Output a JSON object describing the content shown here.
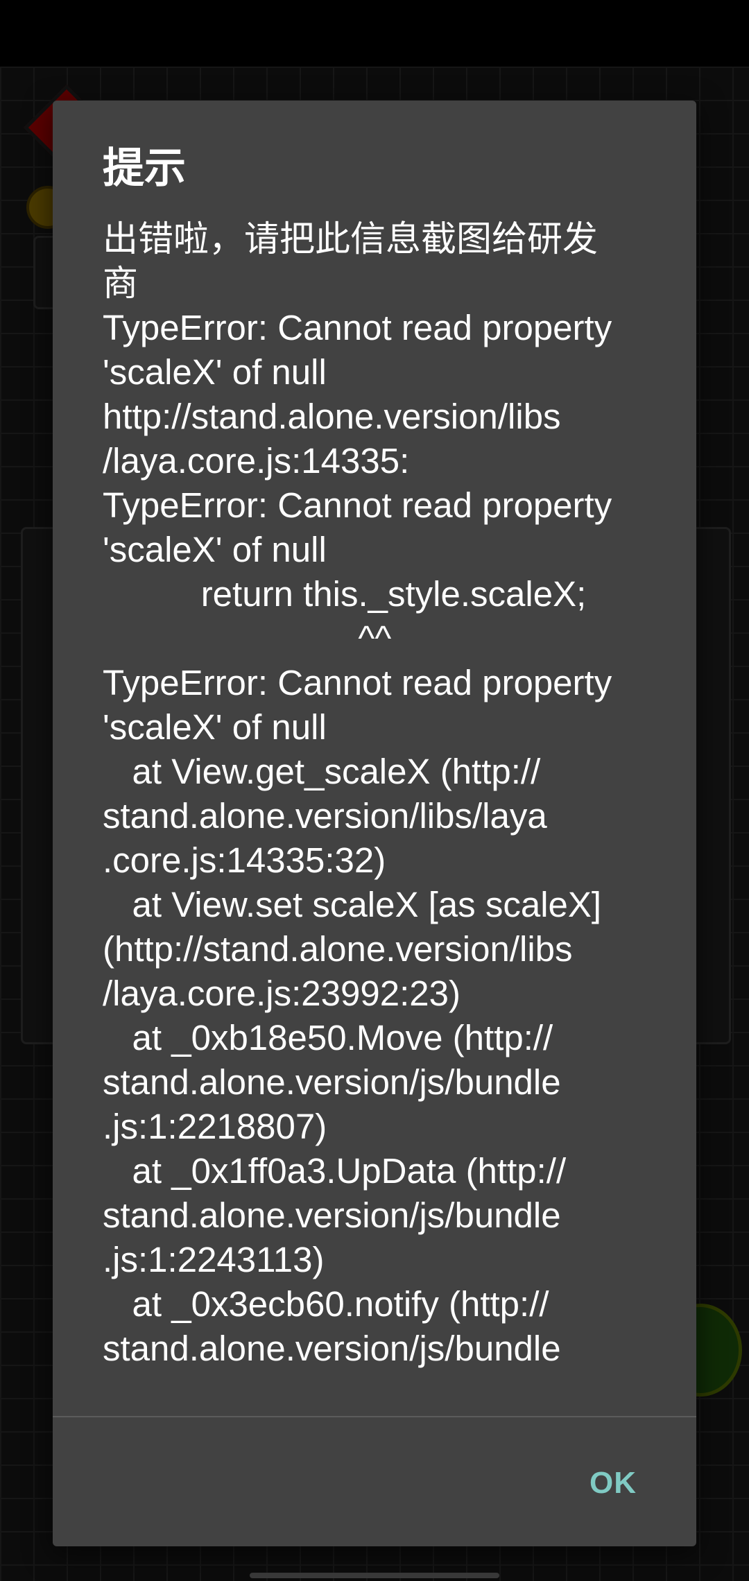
{
  "dialog": {
    "title": "提示",
    "message": "出错啦，请把此信息截图给研发\n商\nTypeError: Cannot read property\n'scaleX' of null\nhttp://stand.alone.version/libs\n/laya.core.js:14335:\nTypeError: Cannot read property\n'scaleX' of null\n          return this._style.scaleX;\n                          ^^\nTypeError: Cannot read property\n'scaleX' of null\n   at View.get_scaleX (http://\nstand.alone.version/libs/laya\n.core.js:14335:32)\n   at View.set scaleX [as scaleX]\n(http://stand.alone.version/libs\n/laya.core.js:23992:23)\n   at _0xb18e50.Move (http://\nstand.alone.version/js/bundle\n.js:1:2218807)\n   at _0x1ff0a3.UpData (http://\nstand.alone.version/js/bundle\n.js:1:2243113)\n   at _0x3ecb60.notify (http://\nstand.alone.version/js/bundle",
    "ok_label": "OK",
    "accent_color": "#80cbc4",
    "background_color": "#424242"
  }
}
